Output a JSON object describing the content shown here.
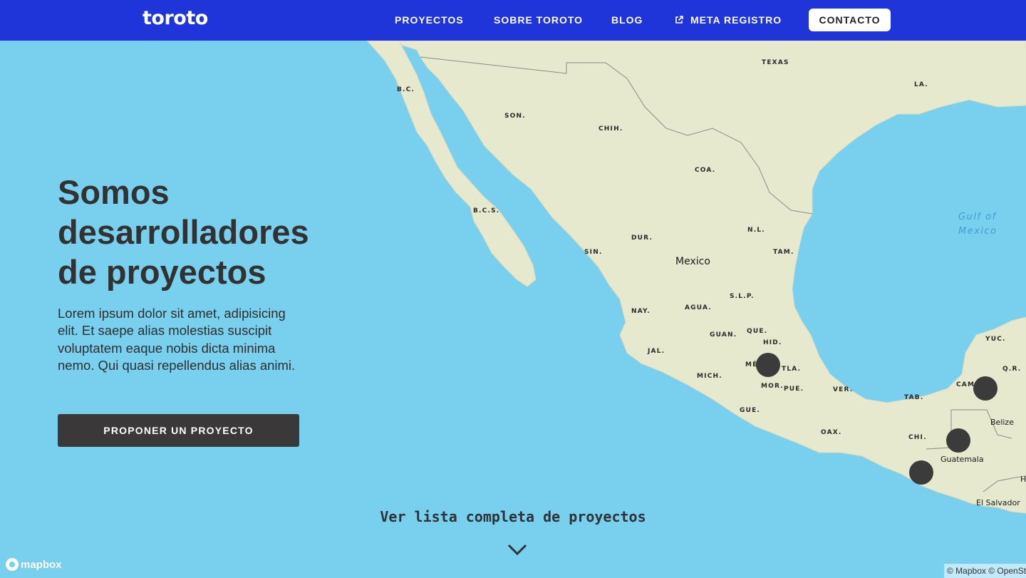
{
  "nav": {
    "logo": "toroto",
    "links": [
      "PROYECTOS",
      "SOBRE TOROTO",
      "BLOG",
      "META REGISTRO"
    ],
    "contact": "CONTACTO",
    "external_link_icon": "external-link-icon"
  },
  "hero": {
    "title": "Somos desarrolladores de proyectos",
    "description": "Lorem ipsum dolor sit amet, adipisicing elit. Et saepe alias molestias suscipit voluptatem eaque nobis dicta minima nemo. Qui quasi repellendus alias animi.",
    "cta": "PROPONER UN PROYECTO"
  },
  "see_all": "Ver lista completa de proyectos",
  "map": {
    "country_label": "Mexico",
    "sea_label_line1": "Gulf of",
    "sea_label_line2": "Mexico",
    "state_labels": [
      "TEXAS",
      "LA.",
      "B.C.",
      "SON.",
      "CHIH.",
      "COA.",
      "B.C.S.",
      "N.L.",
      "DUR.",
      "TAM.",
      "SIN.",
      "S.L.P.",
      "AGUA.",
      "NAY.",
      "QUE.",
      "GUAN.",
      "HID.",
      "JAL.",
      "MÉ",
      "TLA.",
      "MICH.",
      "MOR.",
      "PUE.",
      "VER.",
      "GUE.",
      "TAB.",
      "OAX.",
      "CHI.",
      "YUC.",
      "Q.R.",
      "CAM"
    ],
    "city_labels": [
      "Belize",
      "Guatemala",
      "El Salvador",
      "H"
    ],
    "attribution": "© Mapbox © OpenStreetMap",
    "mapbox_logo": "mapbox"
  },
  "colors": {
    "nav_bg": "#2035d9",
    "water": "#78cfee",
    "land": "#e6e9cd",
    "marker": "#3b3b3b",
    "cta_bg": "#3a3838"
  }
}
